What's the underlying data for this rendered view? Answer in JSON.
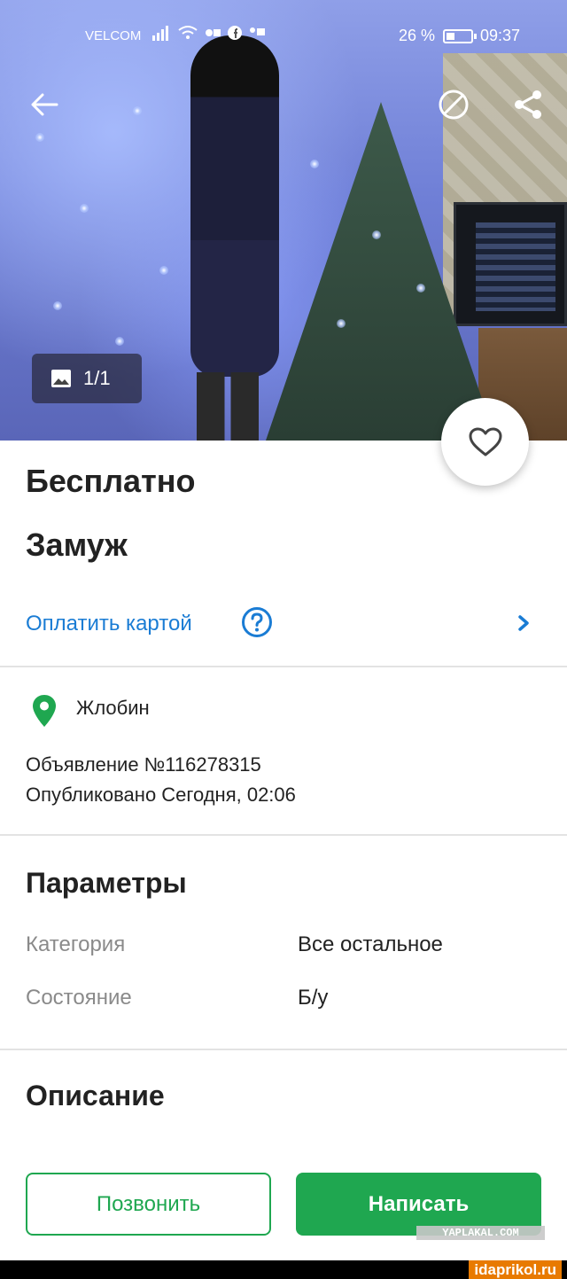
{
  "status_bar": {
    "carrier": "VELCOM",
    "battery_percent": "26 %",
    "time": "09:37"
  },
  "photo": {
    "counter": "1/1"
  },
  "listing": {
    "price": "Бесплатно",
    "title": "Замуж",
    "pay_label": "Оплатить картой",
    "location": "Жлобин",
    "ad_number": "Объявление №116278315",
    "published": "Опубликовано Сегодня, 02:06"
  },
  "params": {
    "title": "Параметры",
    "rows": [
      {
        "key": "Категория",
        "value": "Все остальное"
      },
      {
        "key": "Состояние",
        "value": "Б/у"
      }
    ]
  },
  "description": {
    "title": "Описание"
  },
  "actions": {
    "call_label": "Позвонить",
    "write_label": "Написать"
  },
  "watermarks": {
    "yaplakal": "YAPLAKAL.COM",
    "idaprikol": "idaprikol.ru"
  },
  "colors": {
    "accent_green": "#1fa750",
    "link_blue": "#1a7cd4",
    "pin_green": "#1fa750"
  }
}
